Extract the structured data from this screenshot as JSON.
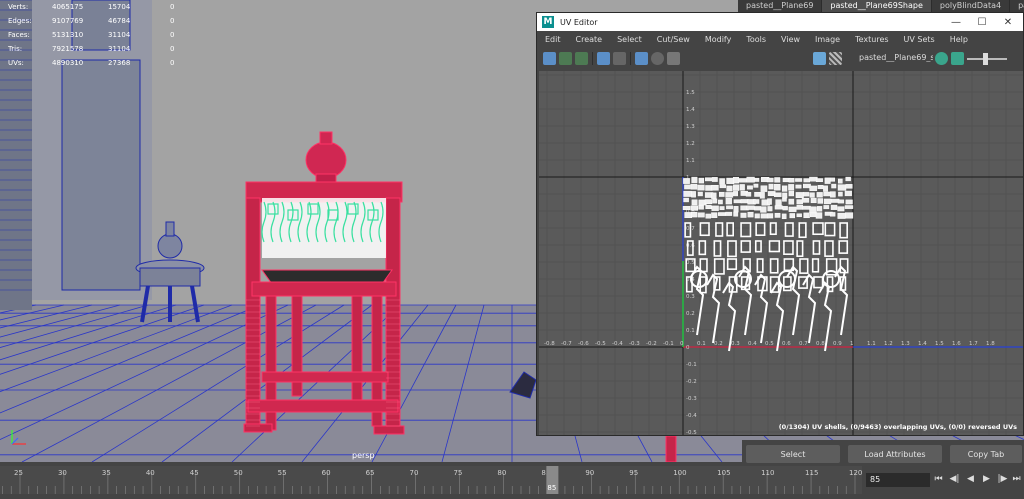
{
  "hud": {
    "rows": [
      {
        "label": "Verts:",
        "v1": "4065175",
        "v2": "15704",
        "v3": "0"
      },
      {
        "label": "Edges:",
        "v1": "9107769",
        "v2": "46784",
        "v3": "0"
      },
      {
        "label": "Faces:",
        "v1": "5131310",
        "v2": "31104",
        "v3": "0"
      },
      {
        "label": "Tris:",
        "v1": "7921578",
        "v2": "31104",
        "v3": "0"
      },
      {
        "label": "UVs:",
        "v1": "4890310",
        "v2": "27368",
        "v3": "0"
      }
    ]
  },
  "viewport": {
    "camera_label": "persp"
  },
  "side_panel": {
    "tabs": [
      "pasted__Plane69",
      "pasted__Plane69Shape",
      "polyBlindData4",
      "pasted__P"
    ],
    "active_tab": 1,
    "buttons": {
      "select": "Select",
      "load_attributes": "Load Attributes",
      "copy_tab": "Copy Tab"
    }
  },
  "uv_editor": {
    "logo": "M",
    "title": "UV Editor",
    "window_controls": {
      "minimize": "—",
      "maximize": "☐",
      "close": "✕"
    },
    "menu": [
      "Edit",
      "Create",
      "Select",
      "Cut/Sew",
      "Modify",
      "Tools",
      "View",
      "Image",
      "Textures",
      "UV Sets",
      "Help"
    ],
    "mesh_name": "pasted__Plane69_shac",
    "status": "(0/1304) UV shells, (0/9463) overlapping UVs, (0/0) reversed UVs",
    "v_labels": [
      "1.5",
      "1.4",
      "1.3",
      "1.2",
      "1.1",
      "1",
      "0.9",
      "0.8",
      "0.7",
      "0.6",
      "0.5",
      "0.4",
      "0.3",
      "0.2",
      "0.1",
      "0",
      "-0.1",
      "-0.2",
      "-0.3",
      "-0.4",
      "-0.5"
    ],
    "u_labels": [
      "-0.8",
      "-0.7",
      "-0.6",
      "-0.5",
      "-0.4",
      "-0.3",
      "-0.2",
      "-0.1",
      "0",
      "0.1",
      "0.2",
      "0.3",
      "0.4",
      "0.5",
      "0.6",
      "0.7",
      "0.8",
      "0.9",
      "1",
      "1.1",
      "1.2",
      "1.3",
      "1.4",
      "1.5",
      "1.6",
      "1.7",
      "1.8"
    ]
  },
  "timeline": {
    "ticks": [
      "25",
      "30",
      "35",
      "40",
      "45",
      "50",
      "55",
      "60",
      "65",
      "70",
      "75",
      "80",
      "85",
      "90",
      "95",
      "100",
      "105",
      "110",
      "115",
      "120"
    ],
    "current_frame": "85",
    "end_field": "85"
  },
  "colors": {
    "viewport_bg": "#9c9c9c",
    "mesh_wire": "#ff2255",
    "selected_green": "#39e0a0",
    "grid_blue": "#1e2bd0",
    "uv_bg": "#5a5a5a"
  }
}
